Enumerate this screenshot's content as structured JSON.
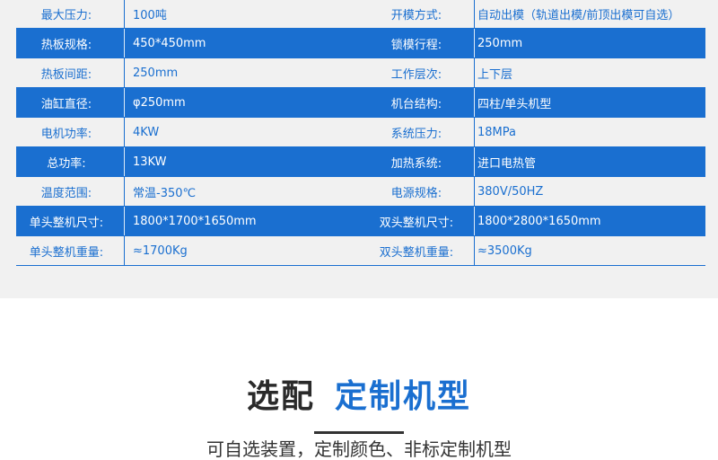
{
  "colors": {
    "accent": "#1a6fd0",
    "panel": "#f1f1f1",
    "heading": "#2a2a2a"
  },
  "spec_rows": [
    {
      "style": "plain",
      "k1": "最大压力:",
      "v1": "100吨",
      "k2": "开模方式:",
      "v2": "自动出模（轨道出模/前顶出模可自选）"
    },
    {
      "style": "blue",
      "k1": "热板规格:",
      "v1": "450*450mm",
      "k2": "锁模行程:",
      "v2": "250mm"
    },
    {
      "style": "plain",
      "k1": "热板间距:",
      "v1": "250mm",
      "k2": "工作层次:",
      "v2": "上下层"
    },
    {
      "style": "blue",
      "k1": "油缸直径:",
      "v1": "φ250mm",
      "k2": "机台结构:",
      "v2": "四柱/单头机型"
    },
    {
      "style": "plain",
      "k1": "电机功率:",
      "v1": "4KW",
      "k2": "系统压力:",
      "v2": "18MPa"
    },
    {
      "style": "blue",
      "k1": "总功率:",
      "v1": "13KW",
      "k2": "加热系统:",
      "v2": "进口电热管"
    },
    {
      "style": "plain",
      "k1": "温度范围:",
      "v1": "常温-350℃",
      "k2": "电源规格:",
      "v2": "380V/50HZ"
    },
    {
      "style": "blue",
      "k1": "单头整机尺寸:",
      "v1": "1800*1700*1650mm",
      "k2": "双头整机尺寸:",
      "v2": "1800*2800*1650mm"
    },
    {
      "style": "plain",
      "k1": "单头整机重量:",
      "v1": "≈1700Kg",
      "k2": "双头整机重量:",
      "v2": "≈3500Kg"
    }
  ],
  "section": {
    "title_part1": "选配",
    "title_part2": "定制机型",
    "subtitle": "可自选装置，定制颜色、非标定制机型"
  }
}
